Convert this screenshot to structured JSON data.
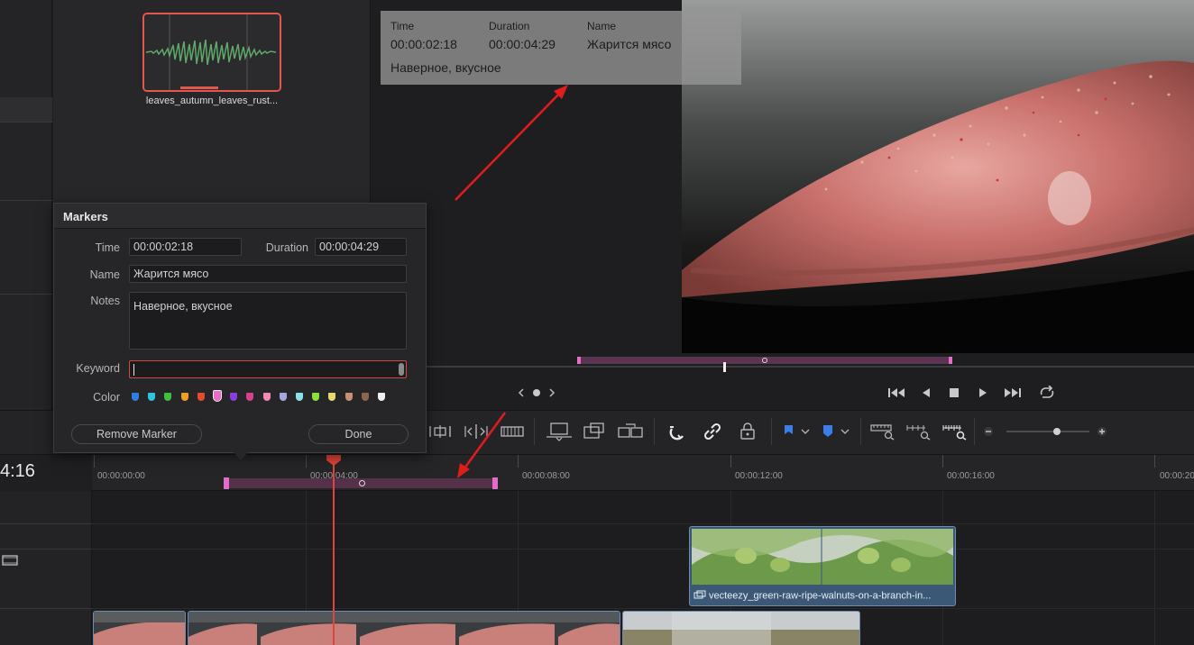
{
  "media_pool": {
    "clip_name": "leaves_autumn_leaves_rust..."
  },
  "viewer": {
    "overlay": {
      "time_label": "Time",
      "time_value": "00:00:02:18",
      "duration_label": "Duration",
      "duration_value": "00:00:04:29",
      "name_label": "Name",
      "name_value": "Жарится мясо",
      "notes_value": "Наверное, вкусное"
    }
  },
  "markers_dialog": {
    "title": "Markers",
    "time_label": "Time",
    "time_value": "00:00:02:18",
    "duration_label": "Duration",
    "duration_value": "00:00:04:29",
    "name_label": "Name",
    "name_value": "Жарится мясо",
    "notes_label": "Notes",
    "notes_value": "Наверное, вкусное",
    "keyword_label": "Keyword",
    "keyword_value": "",
    "color_label": "Color",
    "colors": [
      "#2e7fe0",
      "#2ec4e0",
      "#3cc23c",
      "#f0a020",
      "#e84a2e",
      "#ea6cc6",
      "#8c3ce0",
      "#d8408c",
      "#f08cb4",
      "#a8a8e0",
      "#8ce0e8",
      "#8ce03c",
      "#e8d870",
      "#c89070",
      "#8c6450",
      "#f0f0f0"
    ],
    "selected_color": "#ea6cc6",
    "remove_button": "Remove Marker",
    "done_button": "Done"
  },
  "timeline": {
    "timecode": "4:16",
    "ruler_labels": [
      "00:00:00:00",
      "00:00:04:00",
      "00:00:08:00",
      "00:00:12:00",
      "00:00:16:00",
      "00:00:20"
    ],
    "walnut_clip_name": "vecteezy_green-raw-ripe-walnuts-on-a-branch-in..."
  },
  "colors": {
    "accent_red": "#e4574c",
    "marker_pink": "#e36cc8",
    "clip_blue": "#3b5876"
  }
}
